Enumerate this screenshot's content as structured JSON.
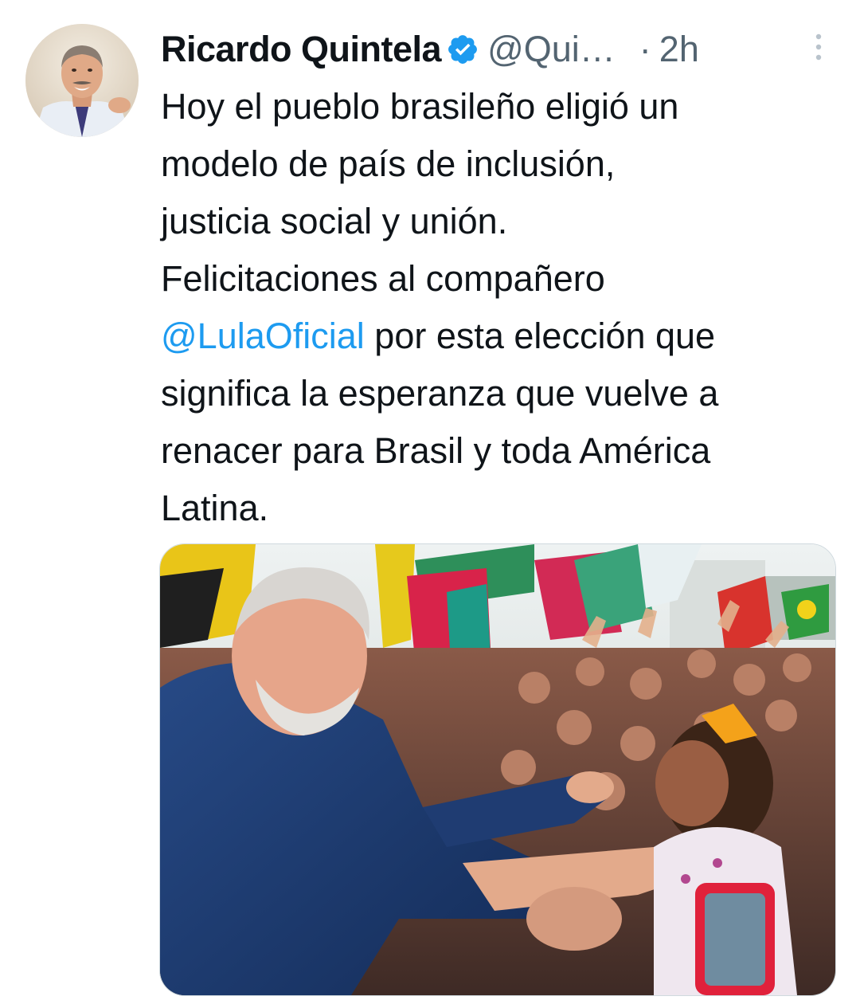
{
  "tweet": {
    "author_name": "Ricardo Quintela",
    "handle": "@Qui…",
    "separator": "·",
    "timestamp": "2h",
    "text_lines": [
      "Hoy el pueblo brasileño eligió un",
      "modelo de país de inclusión,",
      "justicia social y unión.",
      "Felicitaciones al compañero"
    ],
    "mention": "@LulaOficial",
    "after_mention": " por esta elección que",
    "text_lines_end": [
      "significa la esperanza que vuelve a",
      "renacer para Brasil y toda América",
      "Latina."
    ]
  },
  "icons": {
    "verified": "verified-badge-icon",
    "more": "more-options-icon"
  },
  "colors": {
    "text": "#0f1419",
    "secondary": "#536471",
    "link": "#1d9bf0",
    "verified": "#1d9bf0"
  }
}
